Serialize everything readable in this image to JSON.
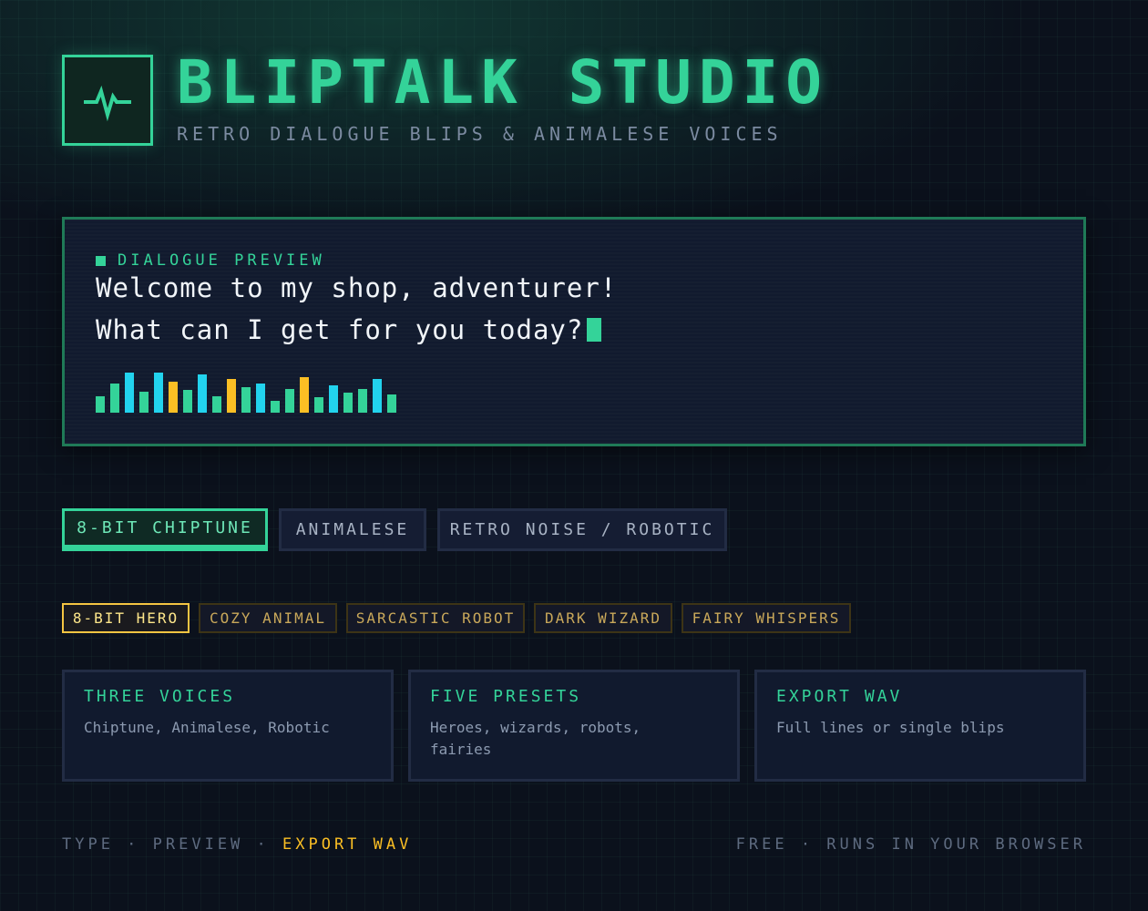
{
  "header": {
    "logo_icon": "pulse-icon",
    "title": "BLIPTALK STUDIO",
    "subtitle": "RETRO DIALOGUE BLIPS & ANIMALESE VOICES"
  },
  "preview": {
    "label": "DIALOGUE PREVIEW",
    "line1": "Welcome to my shop, adventurer!",
    "line2": "What can I get for you today?",
    "waveform": {
      "levels": [
        0.4,
        0.73,
        1.0,
        0.52,
        1.0,
        0.78,
        0.56,
        0.95,
        0.4,
        0.83,
        0.63,
        0.73,
        0.3,
        0.6,
        0.88,
        0.38,
        0.68,
        0.5,
        0.6,
        0.83,
        0.45
      ],
      "colors": [
        "#34d399",
        "#34d399",
        "#22d3ee",
        "#34d399",
        "#22d3ee",
        "#fbbf24",
        "#34d399",
        "#22d3ee",
        "#34d399",
        "#fbbf24",
        "#34d399",
        "#22d3ee",
        "#34d399",
        "#34d399",
        "#fbbf24",
        "#34d399",
        "#22d3ee",
        "#34d399",
        "#34d399",
        "#22d3ee",
        "#34d399"
      ]
    }
  },
  "voice_tabs": [
    {
      "label": "8-BIT CHIPTUNE",
      "active": true
    },
    {
      "label": "ANIMALESE",
      "active": false
    },
    {
      "label": "RETRO NOISE / ROBOTIC",
      "active": false
    }
  ],
  "presets": [
    {
      "label": "8-BIT HERO",
      "active": true
    },
    {
      "label": "COZY ANIMAL",
      "active": false
    },
    {
      "label": "SARCASTIC ROBOT",
      "active": false
    },
    {
      "label": "DARK WIZARD",
      "active": false
    },
    {
      "label": "FAIRY WHISPERS",
      "active": false
    }
  ],
  "features": [
    {
      "title": "THREE VOICES",
      "desc": "Chiptune, Animalese, Robotic"
    },
    {
      "title": "FIVE PRESETS",
      "desc": "Heroes, wizards, robots, fairies"
    },
    {
      "title": "EXPORT WAV",
      "desc": "Full lines or single blips"
    }
  ],
  "footer": {
    "steps_prefix": "TYPE · PREVIEW · ",
    "steps_accent": "EXPORT WAV",
    "right": "FREE · RUNS IN YOUR BROWSER"
  },
  "colors": {
    "accent_green": "#34d399",
    "accent_cyan": "#22d3ee",
    "accent_amber": "#fbbf24",
    "background": "#0b111c"
  }
}
